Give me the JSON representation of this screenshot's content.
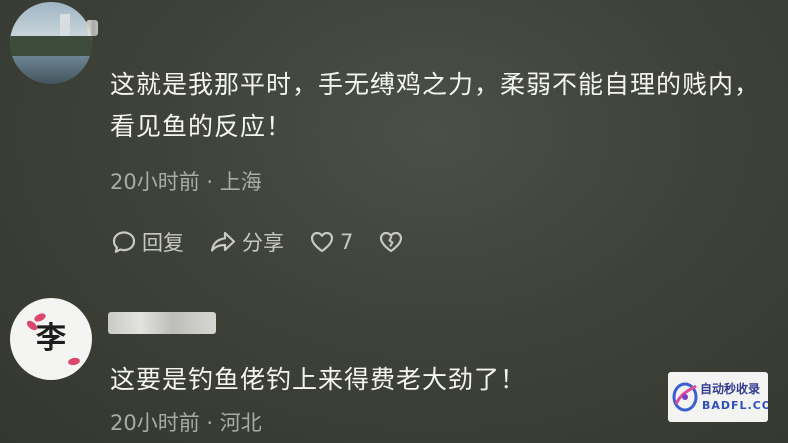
{
  "comments": [
    {
      "text": "这就是我那平时，手无缚鸡之力，柔弱不能自理的贱内，看见鱼的反应！",
      "time": "20小时前",
      "separator": "·",
      "location": "上海",
      "actions": {
        "reply_label": "回复",
        "share_label": "分享",
        "like_count": "7"
      }
    },
    {
      "avatar_text": "李",
      "text": "这要是钓鱼佬钓上来得费老大劲了！",
      "time": "20小时前",
      "separator": "·",
      "location": "河北"
    }
  ],
  "watermark": {
    "top_text": "自动秒收录",
    "bottom_text": "BADFL.COM"
  },
  "colors": {
    "background": "#3e4239",
    "text": "#f4f4f0",
    "meta": "#a9aca3",
    "icon": "#c7c9c2"
  },
  "icons": [
    "comment-bubble-icon",
    "share-arrow-icon",
    "heart-icon",
    "broken-heart-icon"
  ]
}
